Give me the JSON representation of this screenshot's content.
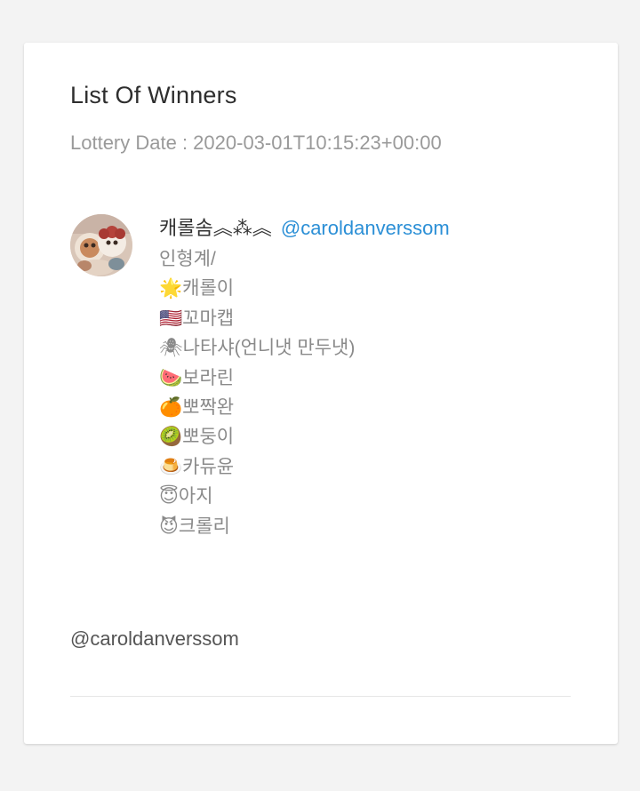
{
  "card": {
    "title": "List Of Winners",
    "lottery_date": "Lottery Date : 2020-03-01T10:15:23+00:00"
  },
  "winner": {
    "display_name": "캐롤솜︽⁂︽",
    "handle": "@caroldanverssom",
    "bio_lines": [
      "인형계/",
      "🌟캐롤이",
      "🇺🇸꼬마캡",
      "🕷나타샤(언니냇 만두냇)",
      "🍉보라린",
      "🍊뽀짝완",
      "🥝뽀둥이",
      "🍮카듀윤",
      "😇아지",
      "😈크롤리"
    ]
  },
  "footer": {
    "handle": "@caroldanverssom"
  },
  "colors": {
    "page_background": "#f3f3f3",
    "card_background": "#ffffff",
    "link": "#2b8fd6",
    "muted_text": "#9a9a9a"
  }
}
